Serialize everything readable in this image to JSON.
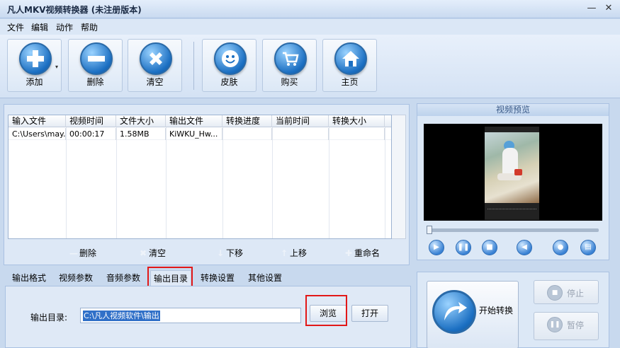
{
  "window": {
    "title": "凡人MKV视频转换器  (未注册版本)",
    "min_symbol": "—",
    "close_symbol": "✕"
  },
  "menu": [
    "文件",
    "编辑",
    "动作",
    "帮助"
  ],
  "toolbar": {
    "add": {
      "label": "添加",
      "icon": "plus-icon"
    },
    "delete": {
      "label": "删除",
      "icon": "minus-icon"
    },
    "clear": {
      "label": "清空",
      "icon": "x-icon"
    },
    "skin": {
      "label": "皮肤",
      "icon": "smiley-icon"
    },
    "buy": {
      "label": "购买",
      "icon": "cart-icon"
    },
    "home": {
      "label": "主页",
      "icon": "home-icon"
    },
    "dropdown_symbol": "▾"
  },
  "file_table": {
    "columns": [
      "输入文件",
      "视频时间",
      "文件大小",
      "输出文件",
      "转换进度",
      "当前时间",
      "转换大小"
    ],
    "rows": [
      [
        "C:\\Users\\may...",
        "00:00:17",
        "1.58MB",
        "KiWKU_Hw...",
        "",
        "",
        ""
      ]
    ]
  },
  "list_actions": {
    "delete": {
      "label": "删除",
      "symbol": "—"
    },
    "clear": {
      "label": "清空",
      "symbol": "✖"
    },
    "down": {
      "label": "下移",
      "symbol": "↓"
    },
    "up": {
      "label": "上移",
      "symbol": "↑"
    },
    "rename": {
      "label": "重命名",
      "symbol": "✚"
    }
  },
  "preview": {
    "title": "视频预览"
  },
  "player": {
    "play": "▶",
    "pause": "❚❚",
    "stop": "■",
    "volume": "◀",
    "snapshot": "●",
    "folder": "▤"
  },
  "tabs": [
    "输出格式",
    "视频参数",
    "音频参数",
    "输出目录",
    "转换设置",
    "其他设置"
  ],
  "active_tab": "输出目录",
  "output": {
    "label": "输出目录:",
    "path": "C:\\凡人视频软件\\输出",
    "browse": "浏览",
    "open": "打开"
  },
  "convert": {
    "start": "开始转换",
    "stop": "停止",
    "pause": "暂停",
    "stop_symbol": "■",
    "pause_symbol": "❚❚"
  },
  "colors": {
    "highlight": "#e21818",
    "accent": "#1b6fc2",
    "background": "#c8d9ee"
  }
}
